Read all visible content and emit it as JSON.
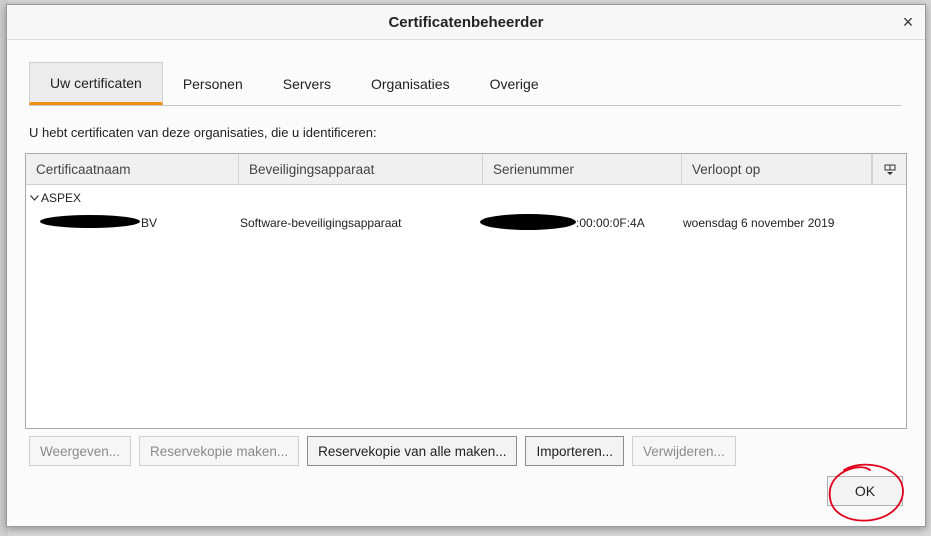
{
  "dialog": {
    "title": "Certificatenbeheerder",
    "close_glyph": "×"
  },
  "tabs": [
    {
      "label": "Uw certificaten",
      "active": true
    },
    {
      "label": "Personen",
      "active": false
    },
    {
      "label": "Servers",
      "active": false
    },
    {
      "label": "Organisaties",
      "active": false
    },
    {
      "label": "Overige",
      "active": false
    }
  ],
  "intro": "U hebt certificaten van deze organisaties, die u identificeren:",
  "table": {
    "columns": [
      "Certificaatnaam",
      "Beveiligingsapparaat",
      "Serienummer",
      "Verloopt op"
    ],
    "group": {
      "name": "ASPEX",
      "expanded": true
    },
    "rows": [
      {
        "name_visible": "BV",
        "device": "Software-beveiligingsapparaat",
        "serial_visible": ":00:00:0F:4A",
        "expires": "woensdag 6 november 2019"
      }
    ]
  },
  "buttons": {
    "view": "Weergeven...",
    "backup": "Reservekopie maken...",
    "backup_all": "Reservekopie van alle maken...",
    "import": "Importeren...",
    "delete": "Verwijderen...",
    "ok": "OK"
  },
  "colors": {
    "active_tab_accent": "#f08f12",
    "annotation": "#e0001b",
    "redaction": "#000000"
  },
  "icons": {
    "column_picker": "column-picker-icon",
    "close": "close-icon",
    "chevron": "chevron-down-icon"
  }
}
